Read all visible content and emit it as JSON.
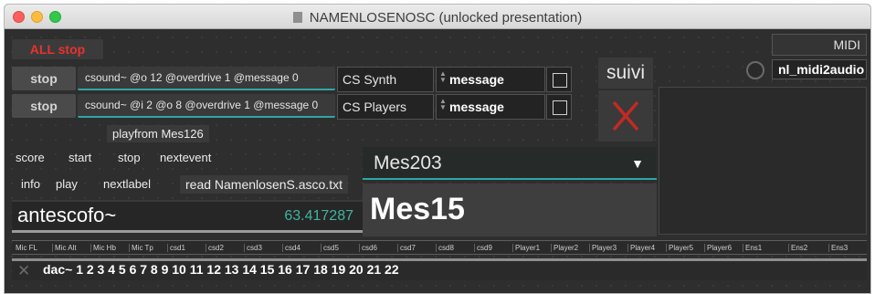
{
  "window": {
    "title": "NAMENLOSENOSC (unlocked presentation)"
  },
  "colors": {
    "accent_cyan": "#2fa6a6",
    "all_stop_red": "#e8322f",
    "close_x_red": "#c32a22",
    "timer_green": "#3fb49f"
  },
  "controls": {
    "all_stop": "ALL stop",
    "stop1": "stop",
    "stop2": "stop",
    "msg1": "csound~ @o 12 @overdrive 1 @message 0",
    "msg2": "csound~ @i 2 @o 8 @overdrive 1 @message 0",
    "menu1": "CS Synth",
    "menu2": "CS Players",
    "num1": "message",
    "num2": "message",
    "suivi": "suivi",
    "midi_label": "MIDI",
    "midi_device": "nl_midi2audio",
    "playfrom": "playfrom Mes126"
  },
  "transport": {
    "score": "score",
    "start": "start",
    "stop": "stop",
    "nextevent": "nextevent",
    "info": "info",
    "play": "play",
    "nextlabel": "nextlabel",
    "read": "read NamenlosenS.asco.txt"
  },
  "antescofo": {
    "label": "antescofo~",
    "value": "63.417287"
  },
  "measures": {
    "menu": "Mes203",
    "current": "Mes15"
  },
  "channel_headers": [
    "Mic FL",
    "Mic Alt",
    "Mic Hb",
    "Mic Tp",
    "csd1",
    "csd2",
    "csd3",
    "csd4",
    "csd5",
    "csd6",
    "csd7",
    "csd8",
    "csd9",
    "Player1",
    "Player2",
    "Player3",
    "Player4",
    "Player5",
    "Player6",
    "Ens1",
    "Ens2",
    "Ens3"
  ],
  "dac": {
    "label": "dac~ 1 2 3 4 5 6 7 8 9 10 11 12 13 14 15 16 17 18 19 20 21 22"
  }
}
